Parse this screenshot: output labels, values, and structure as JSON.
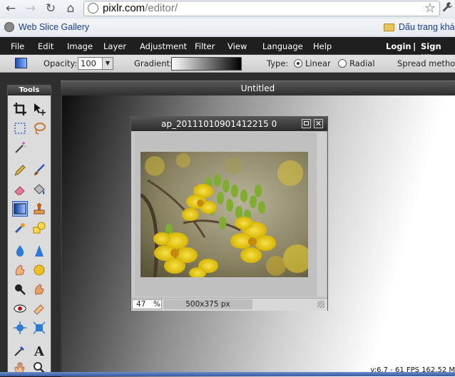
{
  "browser": {
    "url_domain": "pixlr.com",
    "url_path": "/editor/",
    "bookmarks": {
      "left": "Web Slice Gallery",
      "right": "Dấu trang khá"
    }
  },
  "menu": {
    "items": [
      "File",
      "Edit",
      "Image",
      "Layer",
      "Adjustment",
      "Filter",
      "View",
      "Language",
      "Help"
    ],
    "login": "Login",
    "separator": "|",
    "signup": "Sign up"
  },
  "options": {
    "opacity_label": "Opacity:",
    "opacity_value": "100",
    "gradient_label": "Gradient:",
    "type_label": "Type:",
    "type_linear": "Linear",
    "type_radial": "Radial",
    "spread_label": "Spread method"
  },
  "tools": {
    "title": "Tools"
  },
  "document": {
    "title": "Untitled",
    "version_info": "v:6.7 - 61 FPS 162.52 M"
  },
  "image_window": {
    "title": "ap_20111010901412215 0",
    "zoom_value": "47",
    "zoom_unit": "%",
    "dimensions": "500x375 px"
  },
  "colors": {
    "menu_bg": "#1f1f1f",
    "accent_blue": "#3a6fd8"
  }
}
